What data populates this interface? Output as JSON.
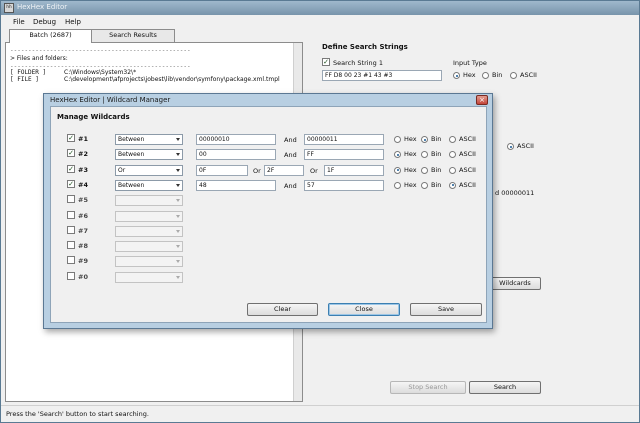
{
  "window": {
    "title": "HexHex Editor",
    "icon": "hh"
  },
  "menu": [
    "File",
    "Debug",
    "Help"
  ],
  "tabs": [
    {
      "label": "Batch (2687)"
    },
    {
      "label": "Search Results"
    }
  ],
  "batch": {
    "heading": "> Files and folders:",
    "rows": [
      {
        "kind": "[ FOLDER ]",
        "path": "C:\\Windows\\System32\\*"
      },
      {
        "kind": "[ FILE ]",
        "path": "C:\\development\\afprojects\\jobest\\lib\\vendor\\symfony\\package.xml.tmpl"
      }
    ]
  },
  "search_panel": {
    "heading": "Define Search Strings",
    "string1": {
      "label": "Search String 1",
      "checked": true,
      "value": "FF D8 00 23 #1 43 #3"
    },
    "input_type_label": "Input Type",
    "radio_options": [
      "Hex",
      "Bin",
      "ASCII"
    ],
    "selected_input_type": "Hex",
    "partial_text": "d 00000011",
    "wildcards_button": "Wildcards",
    "stop_search_button": "Stop Search",
    "search_button": "Search"
  },
  "status": "Press the 'Search' button to start searching.",
  "dialog": {
    "title": "HexHex Editor | Wildcard Manager",
    "heading": "Manage Wildcards",
    "close_icon": "×",
    "radio_options": [
      "Hex",
      "Bin",
      "ASCII"
    ],
    "wildcards": [
      {
        "id": "#1",
        "checked": true,
        "mode": "Between",
        "v1": "00000010",
        "sep": "And",
        "v2": "00000011",
        "type": "Bin"
      },
      {
        "id": "#2",
        "checked": true,
        "mode": "Between",
        "v1": "00",
        "sep": "And",
        "v2": "FF",
        "type": "Hex"
      },
      {
        "id": "#3",
        "checked": true,
        "mode": "Or",
        "v1": "0F",
        "sep": "Or",
        "v2": "2F",
        "sep2": "Or",
        "v3": "1F",
        "type": "Hex"
      },
      {
        "id": "#4",
        "checked": true,
        "mode": "Between",
        "v1": "48",
        "sep": "And",
        "v2": "57",
        "type": "ASCII"
      },
      {
        "id": "#5",
        "checked": false,
        "mode": ""
      },
      {
        "id": "#6",
        "checked": false,
        "mode": ""
      },
      {
        "id": "#7",
        "checked": false,
        "mode": ""
      },
      {
        "id": "#8",
        "checked": false,
        "mode": ""
      },
      {
        "id": "#9",
        "checked": false,
        "mode": ""
      },
      {
        "id": "#0",
        "checked": false,
        "mode": ""
      }
    ],
    "buttons": {
      "clear": "Clear",
      "close": "Close",
      "save": "Save"
    }
  }
}
